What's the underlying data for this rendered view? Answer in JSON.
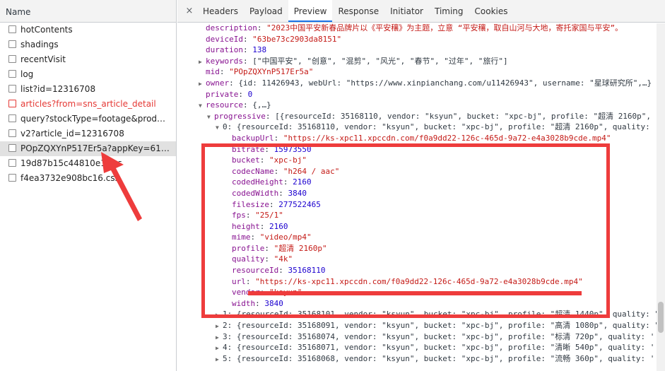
{
  "left_panel": {
    "header": "Name",
    "requests": [
      {
        "name": "hotContents"
      },
      {
        "name": "shadings"
      },
      {
        "name": "recentVisit"
      },
      {
        "name": "log"
      },
      {
        "name": "list?id=12316708"
      },
      {
        "name": "articles?from=sns_article_detail",
        "error": true
      },
      {
        "name": "query?stockType=footage&productTy..."
      },
      {
        "name": "v2?article_id=12316708"
      },
      {
        "name": "POpZQXYnP517Er5a?appKey=61a2f32...",
        "selected": true
      },
      {
        "name": "19d87b15c44810e1.css"
      },
      {
        "name": "f4ea3732e908bc16.css"
      }
    ]
  },
  "tabs": {
    "close_symbol": "×",
    "items": [
      "Headers",
      "Payload",
      "Preview",
      "Response",
      "Initiator",
      "Timing",
      "Cookies"
    ],
    "active": "Preview"
  },
  "preview": {
    "description": {
      "key": "description",
      "value": "\"2023中国平安新春品牌片以《平安穰》为主题，立意 “平安穰，取自山河与大地，寄托家国与平安”。"
    },
    "deviceId": {
      "key": "deviceId",
      "value": "\"63be73c2903da8151\""
    },
    "duration": {
      "key": "duration",
      "value": "138"
    },
    "keywords": {
      "key": "keywords",
      "value": "[\"中国平安\", \"创意\", \"混剪\", \"风光\", \"春节\", \"过年\", \"旅行\"]"
    },
    "mid": {
      "key": "mid",
      "value": "\"POpZQXYnP517Er5a\""
    },
    "owner": {
      "key": "owner",
      "value": "{id: 11426943, webUrl: \"https://www.xinpianchang.com/u11426943\", username: \"星球研究所\",…}"
    },
    "private": {
      "key": "private",
      "value": "0"
    },
    "resource": {
      "key": "resource",
      "value": "{,…}"
    },
    "progressive": {
      "key": "progressive",
      "value": "[{resourceId: 35168110, vendor: \"ksyun\", bucket: \"xpc-bj\", profile: \"超清 2160p\","
    },
    "item0": {
      "key": "0",
      "value": "{resourceId: 35168110, vendor: \"ksyun\", bucket: \"xpc-bj\", profile: \"超清 2160p\", quality:"
    },
    "backupUrl": {
      "key": "backupUrl",
      "value": "\"https://ks-xpc11.xpccdn.com/f0a9dd22-126c-465d-9a72-e4a3028b9cde.mp4\""
    },
    "bitrate": {
      "key": "bitrate",
      "value": "15973550"
    },
    "bucket": {
      "key": "bucket",
      "value": "\"xpc-bj\""
    },
    "codecName": {
      "key": "codecName",
      "value": "\"h264 / aac\""
    },
    "codedHeight": {
      "key": "codedHeight",
      "value": "2160"
    },
    "codedWidth": {
      "key": "codedWidth",
      "value": "3840"
    },
    "filesize": {
      "key": "filesize",
      "value": "277522465"
    },
    "fps": {
      "key": "fps",
      "value": "\"25/1\""
    },
    "height": {
      "key": "height",
      "value": "2160"
    },
    "mime": {
      "key": "mime",
      "value": "\"video/mp4\""
    },
    "profile": {
      "key": "profile",
      "value": "\"超清 2160p\""
    },
    "quality": {
      "key": "quality",
      "value": "\"4k\""
    },
    "resourceId": {
      "key": "resourceId",
      "value": "35168110"
    },
    "url": {
      "key": "url",
      "value": "\"https://ks-xpc11.xpccdn.com/f0a9dd22-126c-465d-9a72-e4a3028b9cde.mp4\""
    },
    "vendor": {
      "key": "vendor",
      "value": "\"ksyun\""
    },
    "width": {
      "key": "width",
      "value": "3840"
    },
    "item1": {
      "key": "1",
      "value": "{resourceId: 35168101, vendor: \"ksyun\", bucket: \"xpc-bj\", profile: \"超清 1440p\", quality: \""
    },
    "item2": {
      "key": "2",
      "value": "{resourceId: 35168091, vendor: \"ksyun\", bucket: \"xpc-bj\", profile: \"高清 1080p\", quality: \""
    },
    "item3": {
      "key": "3",
      "value": "{resourceId: 35168074, vendor: \"ksyun\", bucket: \"xpc-bj\", profile: \"标清 720p\", quality: '"
    },
    "item4": {
      "key": "4",
      "value": "{resourceId: 35168071, vendor: \"ksyun\", bucket: \"xpc-bj\", profile: \"清晰 540p\", quality: '"
    },
    "item5": {
      "key": "5",
      "value": "{resourceId: 35168068, vendor: \"ksyun\", bucket: \"xpc-bj\", profile: \"流畅 360p\", quality: '"
    }
  },
  "colors": {
    "annotation": "#ee3c3c",
    "key": "#881391",
    "string": "#c41a16",
    "number": "#1c00cf",
    "active_tab": "#1a73e8",
    "error": "#e53935"
  },
  "icons": {
    "expand": "triangle-right-icon",
    "collapse": "triangle-down-icon",
    "checkbox": "checkbox-icon",
    "close": "close-icon"
  }
}
